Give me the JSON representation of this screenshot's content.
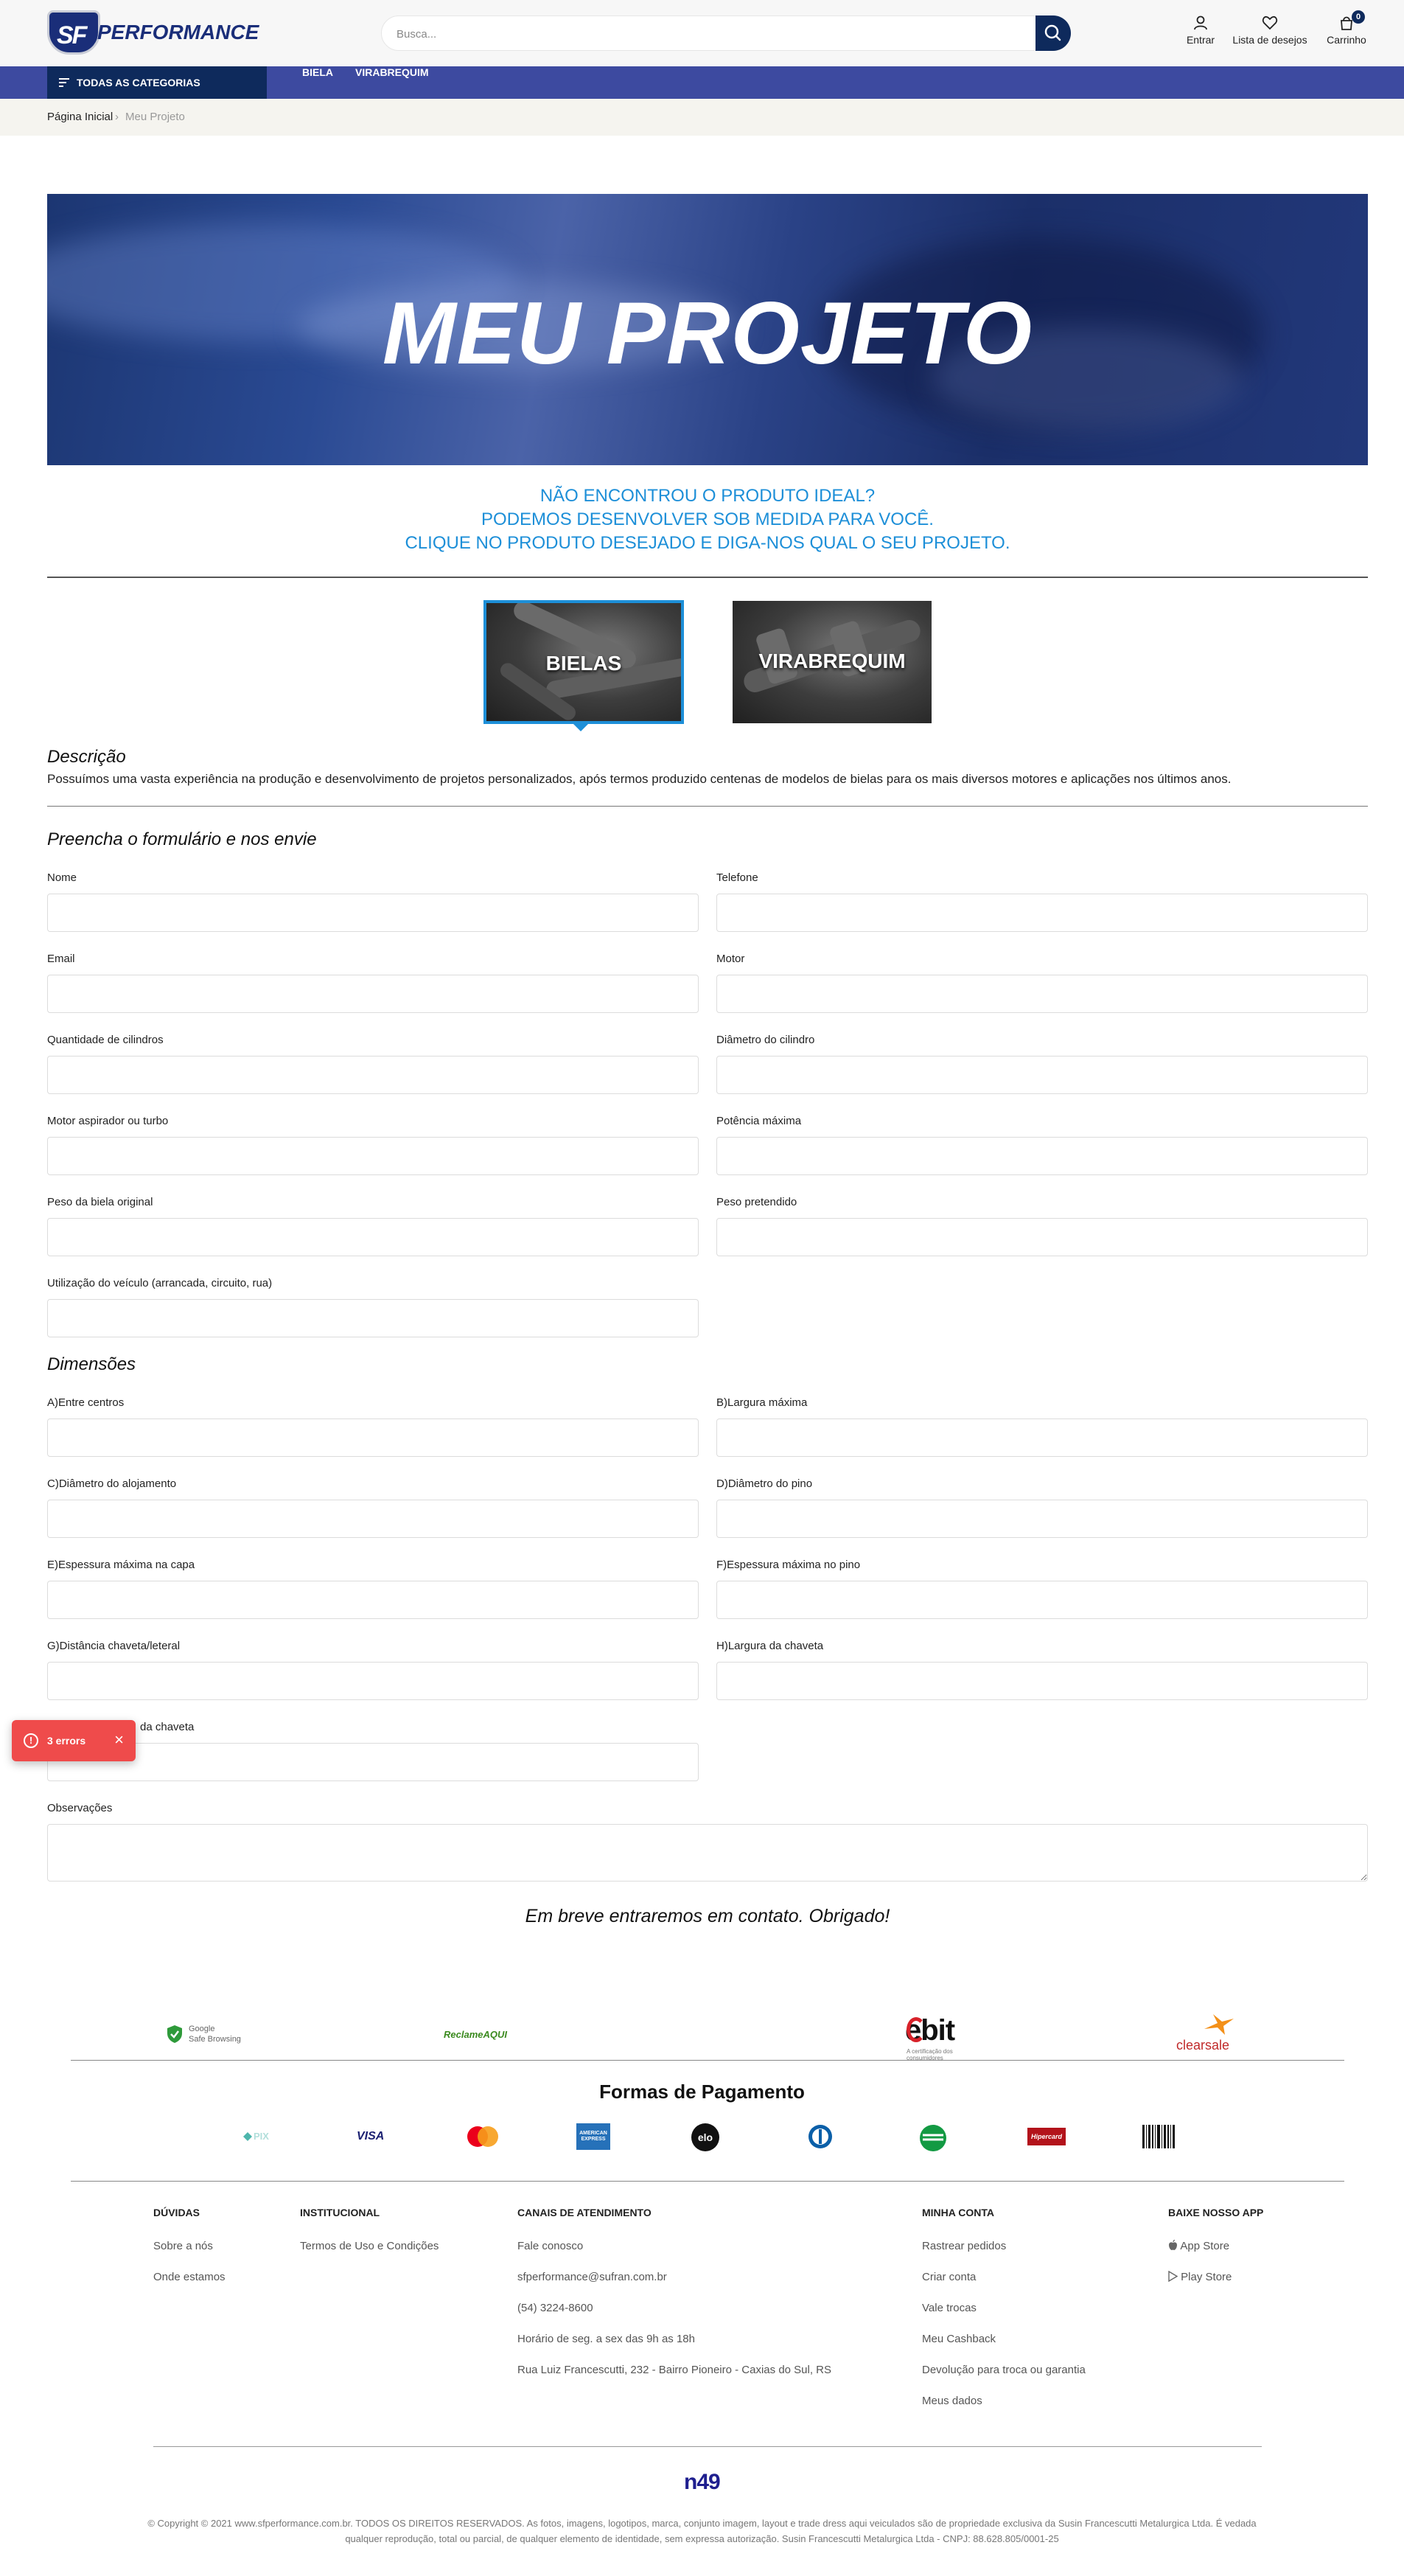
{
  "header": {
    "logo_text": "PERFORMANCE",
    "logo_badge": "SF",
    "search_placeholder": "Busca...",
    "account_label": "Entrar",
    "wishlist_label": "Lista de desejos",
    "cart_label": "Carrinho",
    "cart_count": "0"
  },
  "nav": {
    "categories_label": "TODAS AS CATEGORIAS",
    "links": [
      "BIELA",
      "VIRABREQUIM"
    ]
  },
  "breadcrumb": {
    "home": "Página Inicial",
    "current": "Meu Projeto"
  },
  "banner": {
    "title": "MEU PROJETO"
  },
  "intro": {
    "line1": "NÃO ENCONTROU O PRODUTO IDEAL?",
    "line2": "PODEMOS DESENVOLVER SOB MEDIDA PARA VOCÊ.",
    "line3": "CLIQUE NO PRODUTO DESEJADO E DIGA-NOS QUAL O SEU PROJETO."
  },
  "products": [
    {
      "label": "BIELAS",
      "selected": true
    },
    {
      "label": "VIRABREQUIM",
      "selected": false
    }
  ],
  "description": {
    "title": "Descrição",
    "text": "Possuímos uma vasta experiência na produção e desenvolvimento de projetos personalizados, após termos produzido centenas de modelos de bielas para os mais diversos motores e aplicações nos últimos anos."
  },
  "form": {
    "title": "Preencha o formulário e nos envie",
    "fields": {
      "nome": "Nome",
      "telefone": "Telefone",
      "email": "Email",
      "motor": "Motor",
      "cilindros": "Quantidade de cilindros",
      "diametro_cilindro": "Diâmetro do cilindro",
      "aspirador": "Motor aspirador ou turbo",
      "potencia": "Potência máxima",
      "peso_original": "Peso da biela original",
      "peso_pretendido": "Peso pretendido",
      "utilizacao": "Utilização do veículo (arrancada, circuito, rua)"
    }
  },
  "dimensions": {
    "title": "Dimensões",
    "fields": {
      "a": "A)Entre centros",
      "b": "B)Largura máxima",
      "c": "C)Diâmetro do alojamento",
      "d": "D)Diâmetro do pino",
      "e": "E)Espessura máxima na capa",
      "f": "F)Espessura máxima no pino",
      "g": "G)Distância chaveta/leteral",
      "h": "H)Largura da chaveta",
      "i_partial": "da chaveta",
      "obs": "Observações"
    }
  },
  "thanks": "Em breve entraremos em contato. Obrigado!",
  "toast": {
    "text": "3 errors",
    "icon": "!"
  },
  "seals": {
    "google": "Google",
    "google_sub": "Safe Browsing",
    "reclame": "ReclameAQUI",
    "ebit": "ebit",
    "ebit_sub": "A certificação dos consumidores",
    "clearsale": "clearsale"
  },
  "payments": {
    "title": "Formas de Pagamento",
    "methods": [
      "PIX",
      "VISA",
      "mastercard",
      "AMERICAN EXPRESS",
      "elo",
      "diners",
      "sorocred",
      "Hipercard",
      "boleto"
    ]
  },
  "footer": {
    "duvidas": {
      "title": "DÚVIDAS",
      "links": [
        "Sobre a nós",
        "Onde estamos"
      ]
    },
    "institucional": {
      "title": "INSTITUCIONAL",
      "links": [
        "Termos de Uso e Condições"
      ]
    },
    "canais": {
      "title": "CANAIS DE ATENDIMENTO",
      "links": [
        "Fale conosco",
        "sfperformance@sufran.com.br",
        "(54) 3224-8600",
        "Horário de seg. a sex das 9h as 18h",
        "Rua Luiz Francescutti, 232 - Bairro Pioneiro - Caxias do Sul, RS"
      ]
    },
    "minha_conta": {
      "title": "MINHA CONTA",
      "links": [
        "Rastrear pedidos",
        "Criar conta",
        "Vale trocas",
        "Meu Cashback",
        "Devolução para troca ou garantia",
        "Meus dados"
      ]
    },
    "app": {
      "title": "BAIXE NOSSO APP",
      "links": [
        "App Store",
        "Play Store"
      ]
    },
    "agency": "n49",
    "copyright_1": "© Copyright © 2021 www.sfperformance.com.br. TODOS OS DIREITOS RESERVADOS. As fotos, imagens, logotipos, marca, conjunto imagem, layout e trade dress aqui veiculados são de propriedade exclusiva da Susin Francescutti Metalurgica Ltda. É vedada",
    "copyright_2": "qualquer reprodução, total ou parcial, de qualquer elemento de identidade, sem expressa autorização. Susin Francescutti Metalurgica Ltda - CNPJ: 88.628.805/0001-25"
  },
  "colors": {
    "brand_navy": "#0e2a5c",
    "nav_blue": "#3d4aa0",
    "intro_blue": "#1d8fd8",
    "error_red": "#ef4b4b"
  }
}
